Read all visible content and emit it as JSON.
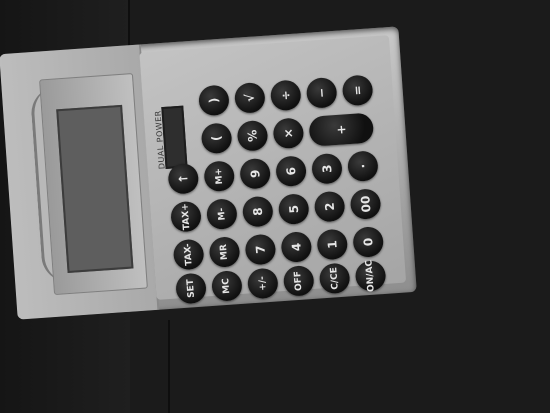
{
  "calculator": {
    "label": "DUAL POWER",
    "keys": [
      {
        "label": ")"
      },
      {
        "label": "√"
      },
      {
        "label": "÷"
      },
      {
        "label": "−"
      },
      {
        "label": "="
      },
      {
        "label": "("
      },
      {
        "label": "%"
      },
      {
        "label": "×"
      },
      {
        "label": "+"
      },
      {
        "label": "↑"
      },
      {
        "label": "M+"
      },
      {
        "label": "9"
      },
      {
        "label": "6"
      },
      {
        "label": "3"
      },
      {
        "label": "·"
      },
      {
        "label": "TAX+"
      },
      {
        "label": "M-"
      },
      {
        "label": "8"
      },
      {
        "label": "5"
      },
      {
        "label": "2"
      },
      {
        "label": "00"
      },
      {
        "label": "TAX-"
      },
      {
        "label": "MR"
      },
      {
        "label": "7"
      },
      {
        "label": "4"
      },
      {
        "label": "1"
      },
      {
        "label": "0"
      },
      {
        "label": "SET"
      },
      {
        "label": "MC"
      },
      {
        "label": "+/-"
      },
      {
        "label": "OFF"
      },
      {
        "label": "C/CE"
      },
      {
        "label": "ON/AC"
      }
    ]
  }
}
